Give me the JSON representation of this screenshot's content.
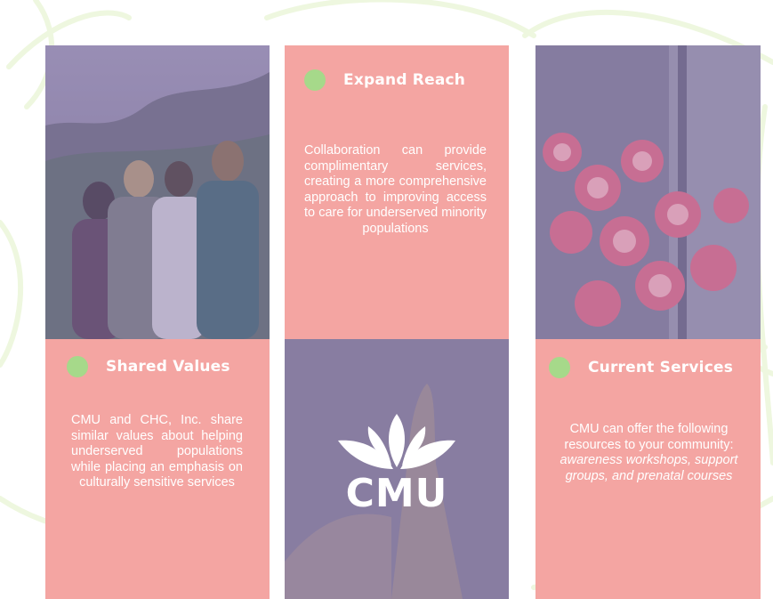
{
  "cards": {
    "expand_reach": {
      "title": "Expand Reach",
      "body": "Collaboration can provide complimentary services, creating a more comprehensive approach to improving access to care for underserved minority populations"
    },
    "shared_values": {
      "title": "Shared Values",
      "body": "CMU and CHC, Inc. share similar values about helping underserved populations while placing an emphasis on culturally sensitive services"
    },
    "current_services": {
      "title": "Current Services",
      "body": "CMU can offer the following resources to your community:",
      "body_italic": "awareness workshops, support groups, and prenatal courses"
    }
  },
  "logo": {
    "text": "CMU"
  },
  "icons": [
    "bullet-dot-icon",
    "cmu-leaf-logo-icon"
  ],
  "colors": {
    "card_pink": "#f4a5a2",
    "photo_overlay": "#8a7fa6",
    "bullet_green": "#a6d98a",
    "swoosh": "#eef7df",
    "text": "#ffffff"
  }
}
